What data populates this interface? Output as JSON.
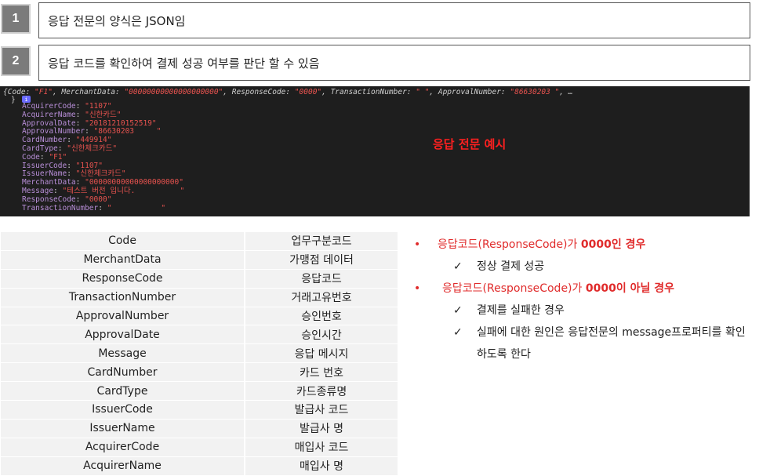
{
  "steps": [
    {
      "number": "1",
      "text": "응답 전문의 양식은 JSON임"
    },
    {
      "number": "2",
      "text": "응답 코드를 확인하여 결제 성공 여부를 판단 할 수 있음"
    }
  ],
  "code_panel": {
    "title": "응답 전문 예시",
    "header_parts": [
      {
        "k": "{Code: ",
        "s": "\"F1\""
      },
      {
        "k": ", MerchantData: ",
        "s": "\"00000000000000000000\""
      },
      {
        "k": ", ResponseCode: ",
        "s": "\"0000\""
      },
      {
        "k": ", TransactionNumber: ",
        "s": "\"           \""
      },
      {
        "k": ", ApprovalNumber: ",
        "s": "\"86630203     \""
      },
      {
        "k": ", …",
        "s": ""
      }
    ],
    "info_icon": "i",
    "close_brace": "}",
    "lines": [
      {
        "key": "AcquirerCode",
        "value": "\"1107\""
      },
      {
        "key": "AcquirerName",
        "value": "\"신한카드\""
      },
      {
        "key": "ApprovalDate",
        "value": "\"20181210152519\""
      },
      {
        "key": "ApprovalNumber",
        "value": "\"86630203     \""
      },
      {
        "key": "CardNumber",
        "value": "\"449914\""
      },
      {
        "key": "CardType",
        "value": "\"신한체크카드\""
      },
      {
        "key": "Code",
        "value": "\"F1\""
      },
      {
        "key": "IssuerCode",
        "value": "\"1107\""
      },
      {
        "key": "IssuerName",
        "value": "\"신한체크카드\""
      },
      {
        "key": "MerchantData",
        "value": "\"00000000000000000000\""
      },
      {
        "key": "Message",
        "value": "\"테스트 버전 입니다.          \""
      },
      {
        "key": "ResponseCode",
        "value": "\"0000\""
      },
      {
        "key": "TransactionNumber",
        "value": "\"           \""
      }
    ]
  },
  "field_table": [
    {
      "name": "Code",
      "desc": "업무구분코드"
    },
    {
      "name": "MerchantData",
      "desc": "가맹점 데이터"
    },
    {
      "name": "ResponseCode",
      "desc": "응답코드"
    },
    {
      "name": "TransactionNumber",
      "desc": "거래고유번호"
    },
    {
      "name": "ApprovalNumber",
      "desc": "승인번호"
    },
    {
      "name": "ApprovalDate",
      "desc": "승인시간"
    },
    {
      "name": "Message",
      "desc": "응답 메시지"
    },
    {
      "name": "CardNumber",
      "desc": "카드 번호"
    },
    {
      "name": "CardType",
      "desc": "카드종류명"
    },
    {
      "name": "IssuerCode",
      "desc": "발급사 코드"
    },
    {
      "name": "IssuerName",
      "desc": "발급사 명"
    },
    {
      "name": "AcquirerCode",
      "desc": "매입사 코드"
    },
    {
      "name": "AcquirerName",
      "desc": "매입사 명"
    }
  ],
  "notes": {
    "bullet": "•",
    "check": "✓",
    "success": {
      "prefix": "응답코드(ResponseCode)가 ",
      "bold": "0000인 경우",
      "sub": "정상 결제 성공"
    },
    "failure": {
      "prefix": "응답코드(ResponseCode)가 ",
      "bold": "0000이 아닐 경우",
      "subs": [
        "결제를 실패한 경우",
        "실패에 대한 원인은 응답전문의 message프로퍼티를 확인하도록 한다"
      ]
    }
  },
  "colors": {
    "accent_red": "#e02b2b",
    "code_bg": "#1e1e1e",
    "step_num_bg": "#7b7b7b"
  }
}
